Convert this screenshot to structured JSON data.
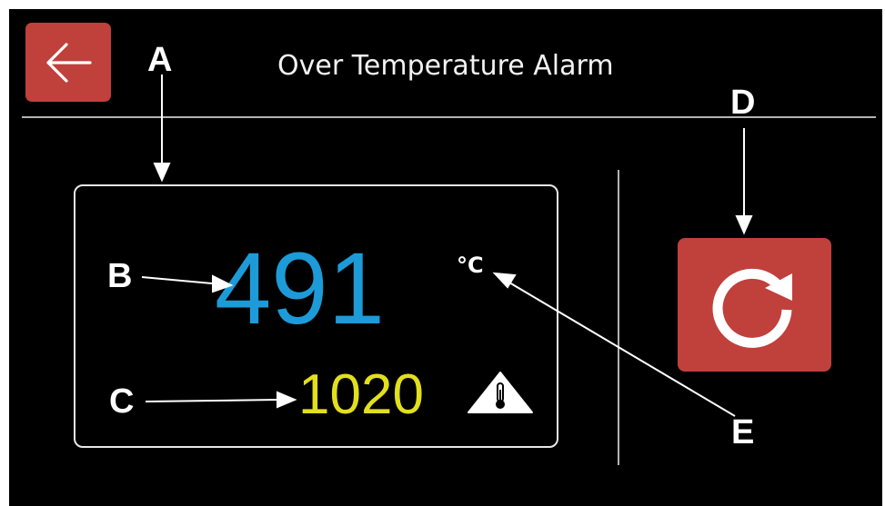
{
  "header": {
    "title": "Over Temperature Alarm",
    "back_icon": "arrow-left-icon"
  },
  "panel": {
    "current_temperature": "491",
    "unit": "°C",
    "setpoint": "1020",
    "alarm_icon": "temperature-warning-icon"
  },
  "actions": {
    "reset_icon": "reset-icon"
  },
  "callouts": {
    "a": "A",
    "b": "B",
    "c": "C",
    "d": "D",
    "e": "E"
  },
  "colors": {
    "background": "#000000",
    "accent_button": "#c0403c",
    "current_temperature": "#1d9bd8",
    "setpoint": "#e2df1c",
    "divider": "#b3b3b3"
  }
}
